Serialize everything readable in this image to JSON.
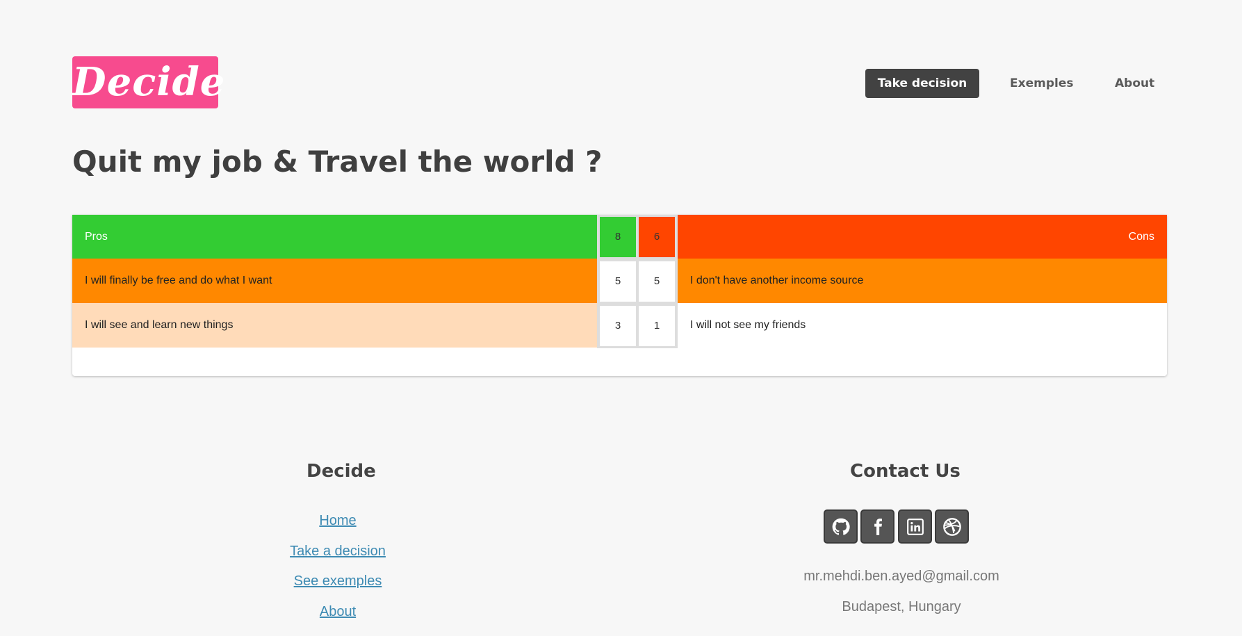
{
  "brand": {
    "logo_text": "Decide",
    "color": "#f74b8e"
  },
  "nav": {
    "items": [
      {
        "label": "Take decision",
        "active": true
      },
      {
        "label": "Exemples",
        "active": false
      },
      {
        "label": "About",
        "active": false
      }
    ]
  },
  "page_title": "Quit my job & Travel the world ?",
  "board": {
    "pros_label": "Pros",
    "cons_label": "Cons",
    "pros_total": "8",
    "cons_total": "6",
    "colors": {
      "pros_header": "#33cc33",
      "cons_header": "#ff4500",
      "high_weight": "#ff8800",
      "low_weight": "#ffdbb9"
    },
    "rows": [
      {
        "pro": "I will finally be free and do what I want",
        "pro_score": "5",
        "con_score": "5",
        "con": "I don't have another income source"
      },
      {
        "pro": "I will see and learn new things",
        "pro_score": "3",
        "con_score": "1",
        "con": "I will not see my friends"
      }
    ]
  },
  "footer": {
    "left": {
      "title": "Decide",
      "links": [
        "Home",
        "Take a decision",
        "See exemples",
        "About"
      ]
    },
    "right": {
      "title": "Contact Us",
      "social": [
        "github-icon",
        "facebook-icon",
        "linkedin-icon",
        "dribbble-icon"
      ],
      "email": "mr.mehdi.ben.ayed@gmail.com",
      "location": "Budapest, Hungary"
    }
  }
}
